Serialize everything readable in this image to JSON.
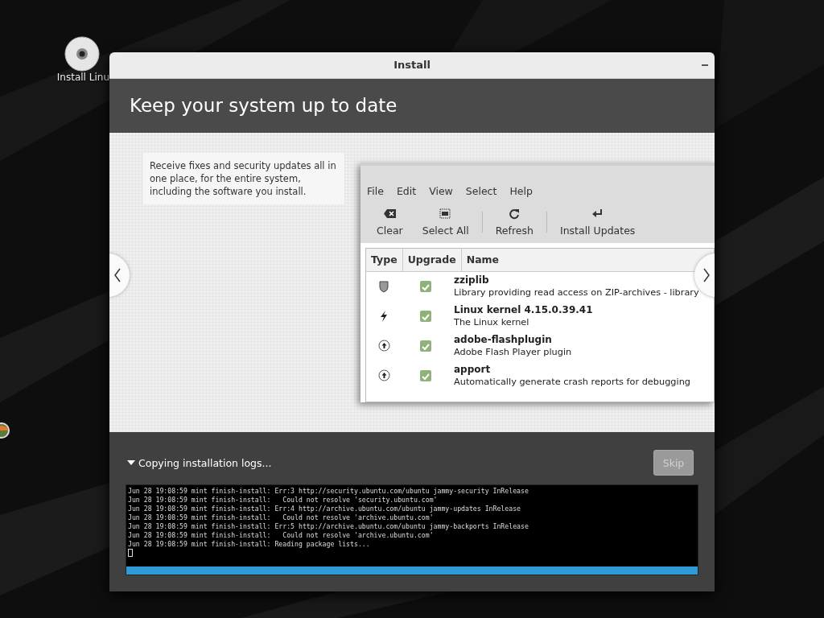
{
  "desktop": {
    "icons": [
      {
        "label": "Install Linu",
        "kind": "disc"
      },
      {
        "kind": "badge"
      }
    ]
  },
  "window": {
    "title": "Install"
  },
  "header": {
    "title": "Keep your system up to date"
  },
  "slide": {
    "description": "Receive fixes and security updates all in one place, for the entire system, including the software you install.",
    "screenshot": {
      "menu": [
        "File",
        "Edit",
        "View",
        "Select",
        "Help"
      ],
      "toolbar": [
        {
          "label": "Clear",
          "kind": "clear"
        },
        {
          "label": "Select All",
          "kind": "select"
        },
        {
          "label": "Refresh",
          "kind": "refresh"
        },
        {
          "label": "Install Updates",
          "kind": "install"
        }
      ],
      "columns": [
        "Type",
        "Upgrade",
        "Name"
      ],
      "rows": [
        {
          "kind": "security",
          "checked": true,
          "name": "zziplib",
          "description": "Library providing read access on ZIP-archives - library"
        },
        {
          "kind": "kernel",
          "checked": true,
          "name": "Linux kernel 4.15.0.39.41",
          "description": "The Linux kernel"
        },
        {
          "kind": "package",
          "checked": true,
          "name": "adobe-flashplugin",
          "description": "Adobe Flash Player plugin"
        },
        {
          "kind": "package",
          "checked": true,
          "name": "apport",
          "description": "Automatically generate crash reports for debugging"
        }
      ]
    }
  },
  "footer": {
    "expander": {
      "label": "Copying installation logs...",
      "expanded": true
    },
    "skip": {
      "label": "Skip",
      "disabled": true
    },
    "log": [
      "Jun 28 19:08:59 mint finish-install: Err:3 http://security.ubuntu.com/ubuntu jammy-security InRelease",
      "Jun 28 19:08:59 mint finish-install:   Could not resolve 'security.ubuntu.com'",
      "Jun 28 19:08:59 mint finish-install: Err:4 http://archive.ubuntu.com/ubuntu jammy-updates InRelease",
      "Jun 28 19:08:59 mint finish-install:   Could not resolve 'archive.ubuntu.com'",
      "Jun 28 19:08:59 mint finish-install: Err:5 http://archive.ubuntu.com/ubuntu jammy-backports InRelease",
      "Jun 28 19:08:59 mint finish-install:   Could not resolve 'archive.ubuntu.com'",
      "Jun 28 19:08:59 mint finish-install: Reading package lists..."
    ],
    "progress": {
      "level": 1
    }
  }
}
